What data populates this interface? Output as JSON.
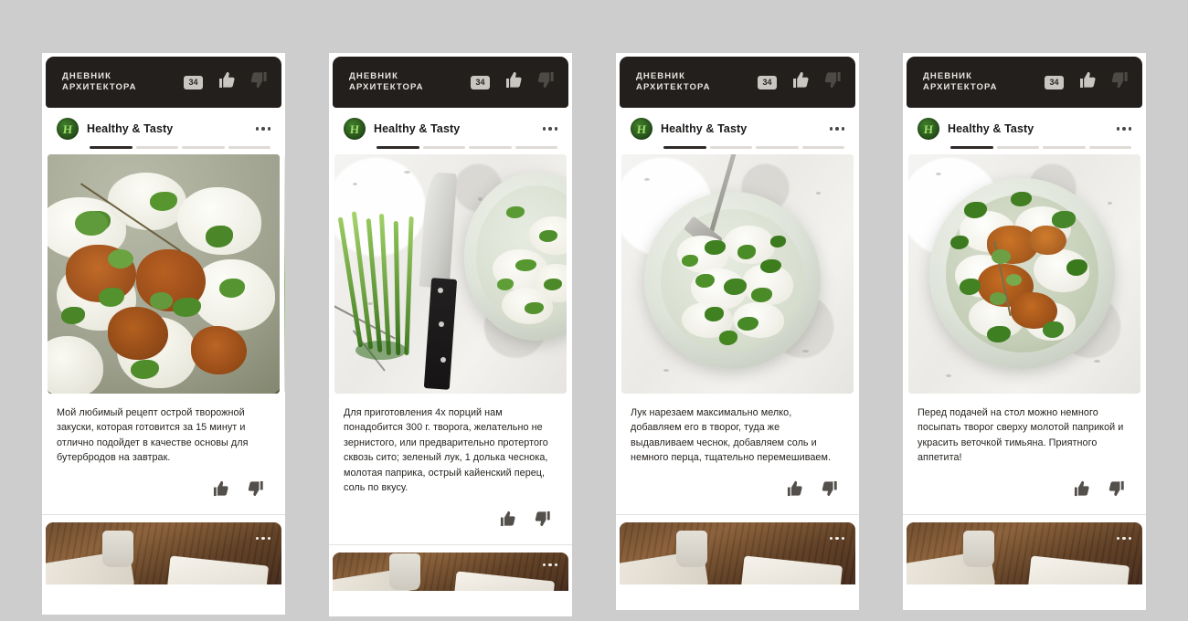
{
  "background_color": "#cdcdcd",
  "panel_count": 4,
  "topbar": {
    "brand_line1": "ДНЕВНИК",
    "brand_line2": "АРХИТЕКТОРА",
    "brand_full": "ДНЕВНИК\nАРХИТЕКТОРА",
    "badge_count": "34",
    "like_icon": "thumbs-up-icon",
    "dislike_icon": "thumbs-down-icon",
    "background_color": "#231f1d",
    "text_color": "#e9e6e2"
  },
  "channel": {
    "name": "Healthy & Tasty",
    "avatar_letter": "Н",
    "avatar_color": "#2c5b1e",
    "avatar_glyph_color": "#9ddc6a",
    "menu_icon": "more-options-icon"
  },
  "progress": {
    "segments": 4,
    "active_index": 0
  },
  "reactions": {
    "like_icon": "thumbs-up-icon",
    "dislike_icon": "thumbs-down-icon",
    "icon_color": "#53504c"
  },
  "next_card": {
    "menu_icon": "more-options-icon",
    "description": "wooden-table-photo-peek"
  },
  "panels": [
    {
      "index": 1,
      "photo": "cottage-cheese-with-paprika-closeup",
      "caption": "Мой любимый рецепт острой творожной закуски, которая готовится за 15 минут и отлично подойдет в качестве основы для бутербродов на завтрак.",
      "has_side_peek": true
    },
    {
      "index": 2,
      "photo": "green-onions-knife-and-bowl-on-marble",
      "caption": "Для приготовления 4х порций нам понадобится 300 г. творога, желательно не  зернистого, или предварительно протертого сквозь сито; зеленый лук, 1 долька чеснока, молотая паприка, острый кайенский перец, соль по вкусу.",
      "has_side_peek": false
    },
    {
      "index": 3,
      "photo": "bowl-of-cottage-cheese-with-fork-top-down",
      "caption": "Лук нарезаем максимально мелко, добавляем его в творог, туда же выдавливаем чеснок, добавляем соль и немного перца, тщательно перемешиваем.",
      "has_side_peek": false
    },
    {
      "index": 4,
      "photo": "finished-dish-with-paprika-and-thyme",
      "caption": "Перед подачей на стол можно немного посыпать творог сверху молотой паприкой и украсить веточкой тимьяна. Приятного аппетита!",
      "has_side_peek": false
    }
  ]
}
